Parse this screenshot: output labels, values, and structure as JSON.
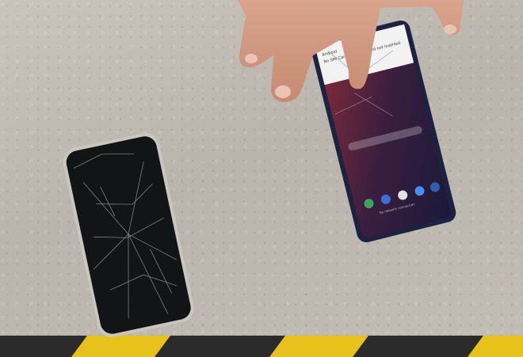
{
  "scene": {
    "description_colors": {
      "concrete": "#bdb9b2",
      "hazard_yellow": "#e6c21b",
      "hazard_black": "#2b2b2b",
      "phone_left_screen": "#121416",
      "phone_right_body": "#1d2240"
    }
  },
  "right_phone": {
    "notification_title": "No SIM Card",
    "notification_time": "Android",
    "notification_extra": "SIM card not inserted",
    "status_footer": "No network connection"
  }
}
